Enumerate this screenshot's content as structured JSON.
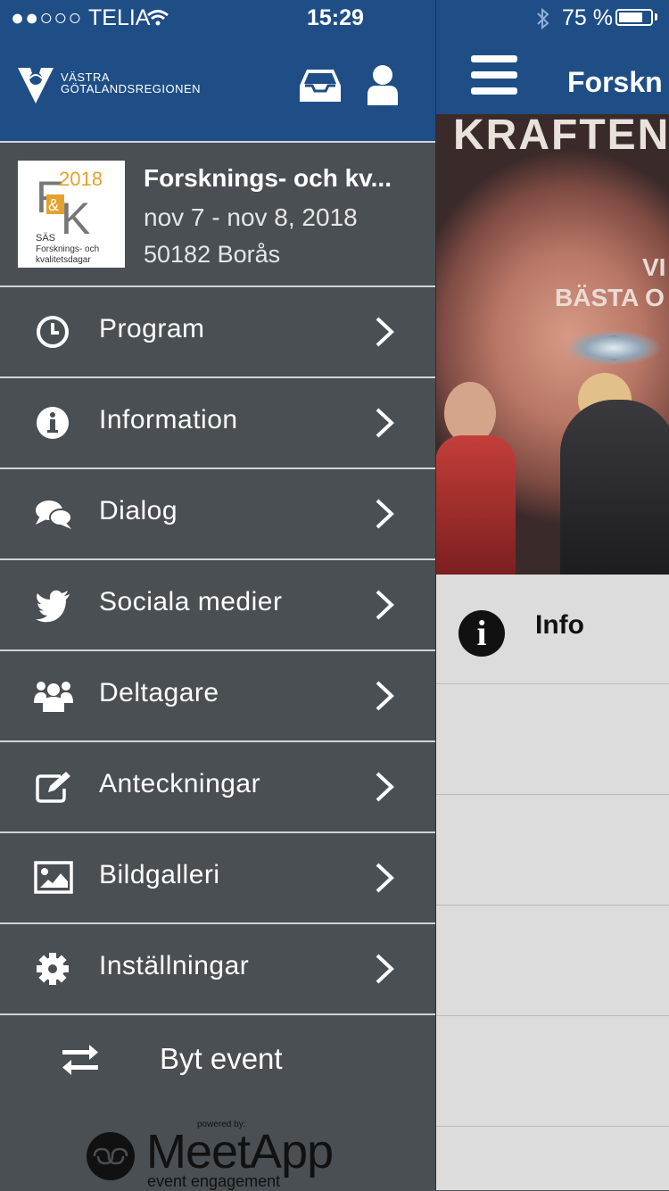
{
  "status_bar": {
    "signal_dots": "●●○○○",
    "carrier": "TELIA",
    "time": "15:29",
    "battery_percent": "75 %",
    "battery_level": 0.75
  },
  "drawer": {
    "org_name_line1": "VÄSTRA",
    "org_name_line2": "GÖTALANDSREGIONEN",
    "event": {
      "logo_year": "2018",
      "logo_org": "SÄS",
      "logo_line1": "Forsknings- och",
      "logo_line2": "kvalitetsdagar",
      "title": "Forsknings- och kv...",
      "dates": "nov 7 - nov 8, 2018",
      "location": "50182 Borås"
    },
    "menu": [
      {
        "label": "Program",
        "icon": "clock-icon"
      },
      {
        "label": "Information",
        "icon": "info-icon"
      },
      {
        "label": "Dialog",
        "icon": "chat-bubbles-icon"
      },
      {
        "label": "Sociala medier",
        "icon": "twitter-icon"
      },
      {
        "label": "Deltagare",
        "icon": "users-icon"
      },
      {
        "label": "Anteckningar",
        "icon": "edit-note-icon"
      },
      {
        "label": "Bildgalleri",
        "icon": "image-icon"
      },
      {
        "label": "Inställningar",
        "icon": "gear-icon"
      }
    ],
    "switch_event_label": "Byt event",
    "powered_by": "powered by:",
    "brand_name": "MeetApp",
    "brand_tagline": "event engagement"
  },
  "background_page": {
    "title": "Forskn",
    "hero_text_1": "KRAFTEN",
    "hero_text_2": "VI",
    "hero_text_3": "BÄSTA O",
    "info_label": "Info"
  },
  "colors": {
    "header_blue": "#1f4e86",
    "drawer_gray": "#4a4f54",
    "divider": "#d0d4d8",
    "page_gray": "#dcdcdc",
    "logo_orange": "#e5a22a"
  }
}
